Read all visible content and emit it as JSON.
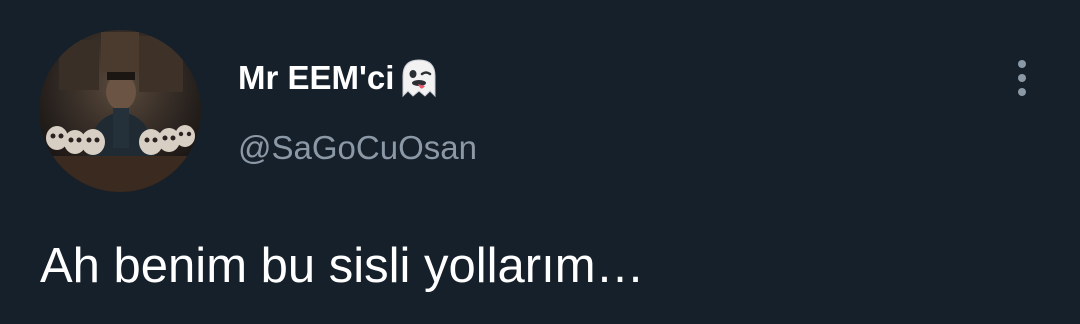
{
  "tweet": {
    "author": {
      "display_name": "Mr EEM'ci",
      "name_emoji": "ghost-emoji",
      "handle": "@SaGoCuOsan"
    },
    "text": "Ah benim bu sisli yollarım…",
    "menu_icon": "more-vertical-icon"
  },
  "colors": {
    "background": "#15202b",
    "text": "#ffffff",
    "secondary_text": "#8b98a5",
    "icon": "#8b98a5"
  }
}
